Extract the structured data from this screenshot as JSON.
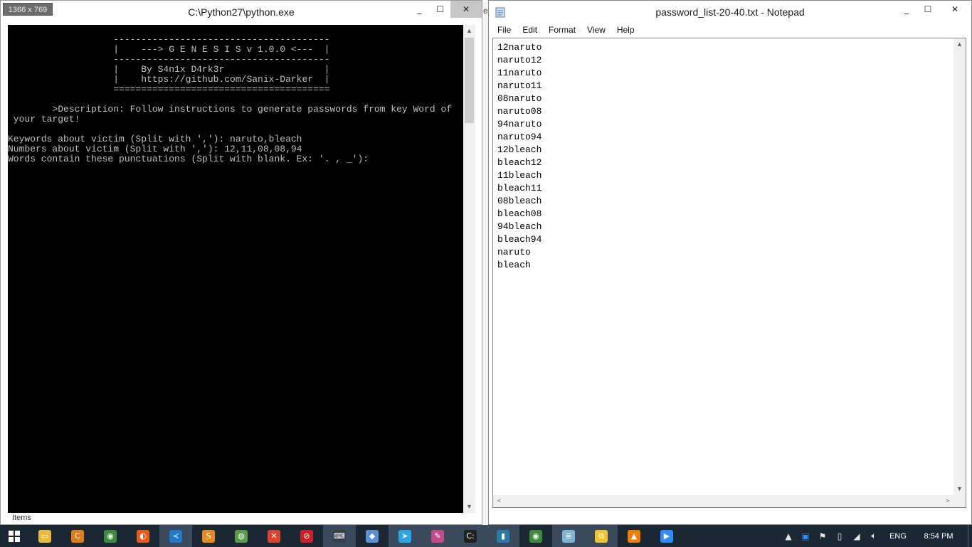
{
  "console": {
    "size_badge": "1366 x 769",
    "title": "C:\\Python27\\python.exe",
    "controls": {
      "minimize": "_",
      "maximize": "☐",
      "close": "✕"
    },
    "scroll_up": "▲",
    "scroll_down": "▼",
    "lines": [
      "",
      "                   ---------------------------------------",
      "                   |    ---> G E N E S I S v 1.0.0 <---  |",
      "                   ---------------------------------------",
      "                   |    By S4n1x D4rk3r                  |",
      "                   |    https://github.com/Sanix-Darker  |",
      "                   =======================================",
      "",
      "        >Description: Follow instructions to generate passwords from key Word of",
      " your target!",
      "",
      "Keywords about victim (Split with ','): naruto,bleach",
      "Numbers about victim (Split with ','): 12,11,08,08,94",
      "Words contain these punctuations (Split with blank. Ex: '. , _'):"
    ],
    "footer_label": "Items"
  },
  "strip_letter": "e",
  "notepad": {
    "title": "password_list-20-40.txt - Notepad",
    "controls": {
      "minimize": "_",
      "maximize": "☐",
      "close": "✕"
    },
    "menu": [
      "File",
      "Edit",
      "Format",
      "View",
      "Help"
    ],
    "lines": [
      "12naruto",
      "naruto12",
      "11naruto",
      "naruto11",
      "08naruto",
      "naruto08",
      "94naruto",
      "naruto94",
      "12bleach",
      "bleach12",
      "11bleach",
      "bleach11",
      "08bleach",
      "bleach08",
      "94bleach",
      "bleach94",
      "naruto",
      "bleach"
    ],
    "scroll_up": "▲",
    "scroll_down": "▼",
    "scroll_left": "<",
    "scroll_right": ">"
  },
  "taskbar": {
    "start_icon": "windows-logo",
    "apps": [
      {
        "name": "file-explorer",
        "glyph": "▭",
        "color": "#e8b93b"
      },
      {
        "name": "ccleaner",
        "glyph": "C",
        "color": "#e07b1a"
      },
      {
        "name": "chrome",
        "glyph": "◉",
        "color": "#3d8a3d"
      },
      {
        "name": "firefox",
        "glyph": "◐",
        "color": "#e8591a"
      },
      {
        "name": "vscode",
        "glyph": "≺",
        "color": "#1f7acc"
      },
      {
        "name": "sublime",
        "glyph": "S",
        "color": "#e58a1f"
      },
      {
        "name": "globe",
        "glyph": "◍",
        "color": "#5a9a4a"
      },
      {
        "name": "xmind",
        "glyph": "✕",
        "color": "#d9432f"
      },
      {
        "name": "blocked-app",
        "glyph": "⊘",
        "color": "#c8222a"
      },
      {
        "name": "terminal-app",
        "glyph": "⌨",
        "color": "#333f4a"
      },
      {
        "name": "virtualbox",
        "glyph": "◆",
        "color": "#5b8fd1"
      },
      {
        "name": "telegram",
        "glyph": "➤",
        "color": "#2ca5e0"
      },
      {
        "name": "paint",
        "glyph": "✎",
        "color": "#c04a8a"
      },
      {
        "name": "cmd",
        "glyph": "C:",
        "color": "#202020"
      },
      {
        "name": "book-app",
        "glyph": "▮",
        "color": "#2a7aa8"
      },
      {
        "name": "chrome-2",
        "glyph": "◉",
        "color": "#3d8a3d"
      },
      {
        "name": "notepad",
        "glyph": "≣",
        "color": "#7fb3d5"
      },
      {
        "name": "python",
        "glyph": "⧉",
        "color": "#f0c430"
      },
      {
        "name": "vlc",
        "glyph": "▲",
        "color": "#f07c00"
      },
      {
        "name": "zoom",
        "glyph": "▶",
        "color": "#2d8cff"
      }
    ],
    "tray": {
      "chevron": "▲",
      "lang": "ENG",
      "clock": "8:54 PM"
    }
  }
}
